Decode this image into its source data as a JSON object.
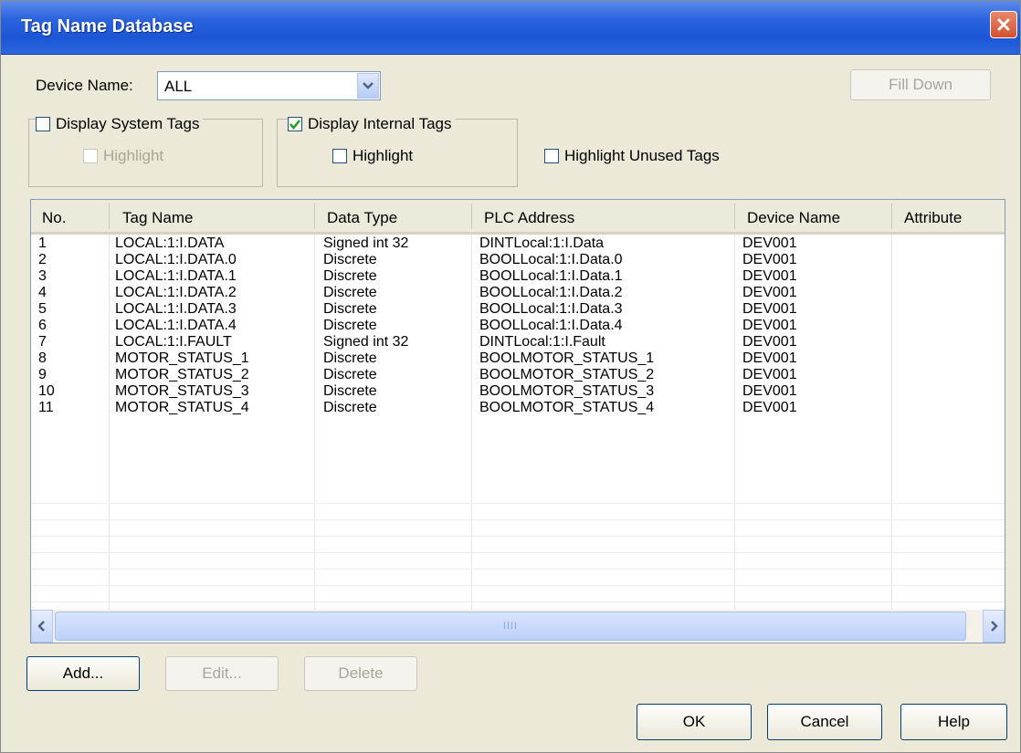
{
  "window": {
    "title": "Tag Name Database",
    "close_icon": "close-icon"
  },
  "device": {
    "label": "Device Name:",
    "selected": "ALL",
    "dropdown_icon": "chevron-down-icon"
  },
  "fill_down_label": "Fill Down",
  "system_tags": {
    "label": "Display System Tags",
    "checked": false,
    "highlight_label": "Highlight",
    "highlight_enabled": false
  },
  "internal_tags": {
    "label": "Display Internal Tags",
    "checked": true,
    "highlight_label": "Highlight",
    "highlight_checked": false
  },
  "highlight_unused_label": "Highlight Unused Tags",
  "table": {
    "columns": [
      "No.",
      "Tag Name",
      "Data Type",
      "PLC Address",
      "Device Name",
      "Attribute"
    ],
    "rows": [
      [
        "1",
        "LOCAL:1:I.DATA",
        "Signed int 32",
        "DINTLocal:1:I.Data",
        "DEV001",
        ""
      ],
      [
        "2",
        "LOCAL:1:I.DATA.0",
        "Discrete",
        "BOOLLocal:1:I.Data.0",
        "DEV001",
        ""
      ],
      [
        "3",
        "LOCAL:1:I.DATA.1",
        "Discrete",
        "BOOLLocal:1:I.Data.1",
        "DEV001",
        ""
      ],
      [
        "4",
        "LOCAL:1:I.DATA.2",
        "Discrete",
        "BOOLLocal:1:I.Data.2",
        "DEV001",
        ""
      ],
      [
        "5",
        "LOCAL:1:I.DATA.3",
        "Discrete",
        "BOOLLocal:1:I.Data.3",
        "DEV001",
        ""
      ],
      [
        "6",
        "LOCAL:1:I.DATA.4",
        "Discrete",
        "BOOLLocal:1:I.Data.4",
        "DEV001",
        ""
      ],
      [
        "7",
        "LOCAL:1:I.FAULT",
        "Signed int 32",
        "DINTLocal:1:I.Fault",
        "DEV001",
        ""
      ],
      [
        "8",
        "MOTOR_STATUS_1",
        "Discrete",
        "BOOLMOTOR_STATUS_1",
        "DEV001",
        ""
      ],
      [
        "9",
        "MOTOR_STATUS_2",
        "Discrete",
        "BOOLMOTOR_STATUS_2",
        "DEV001",
        ""
      ],
      [
        "10",
        "MOTOR_STATUS_3",
        "Discrete",
        "BOOLMOTOR_STATUS_3",
        "DEV001",
        ""
      ],
      [
        "11",
        "MOTOR_STATUS_4",
        "Discrete",
        "BOOLMOTOR_STATUS_4",
        "DEV001",
        ""
      ]
    ]
  },
  "scrollbar": {
    "left_icon": "scroll-left-icon",
    "right_icon": "scroll-right-icon",
    "grip": "IIII"
  },
  "buttons": {
    "add": "Add...",
    "edit": "Edit...",
    "delete": "Delete",
    "ok": "OK",
    "cancel": "Cancel",
    "help": "Help"
  },
  "colors": {
    "title_bar": "#2a63dd",
    "dialog_bg": "#ece9d8",
    "check_mark": "#21a121"
  }
}
